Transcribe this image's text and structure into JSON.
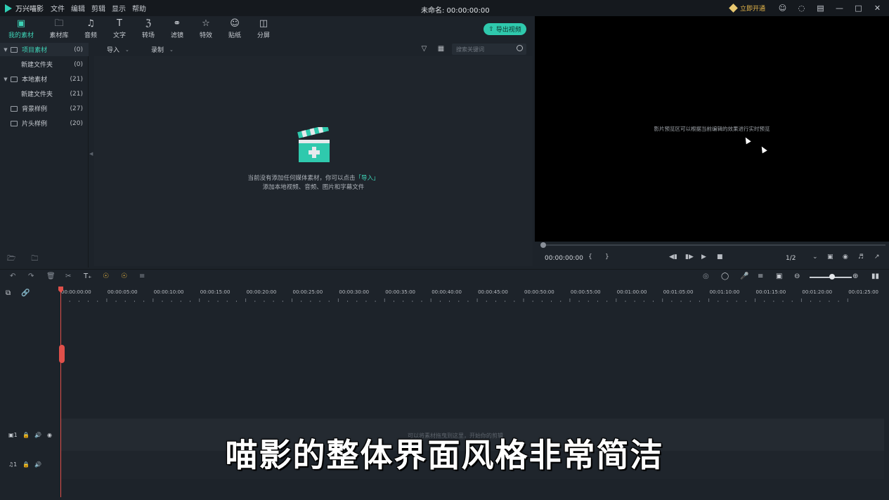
{
  "app": {
    "name": "万兴喵影",
    "menus": [
      "文件",
      "编辑",
      "剪辑",
      "显示",
      "帮助"
    ],
    "doc_title": "未命名: 00:00:00:00",
    "vip_label": "立即开通",
    "window_icons": [
      "user-icon",
      "message-icon",
      "layout-icon",
      "minimize-icon",
      "maximize-icon",
      "close-icon"
    ]
  },
  "media_tabs": [
    {
      "label": "我的素材",
      "icon": "media-icon"
    },
    {
      "label": "素材库",
      "icon": "folder-icon"
    },
    {
      "label": "音频",
      "icon": "music-icon"
    },
    {
      "label": "文字",
      "icon": "text-icon"
    },
    {
      "label": "转场",
      "icon": "transition-icon"
    },
    {
      "label": "滤镜",
      "icon": "filter-icon"
    },
    {
      "label": "特效",
      "icon": "effects-icon"
    },
    {
      "label": "贴纸",
      "icon": "sticker-icon"
    },
    {
      "label": "分屏",
      "icon": "splitscreen-icon"
    }
  ],
  "export_button": "导出视频",
  "folders": [
    {
      "label": "项目素材",
      "count": "(0)"
    },
    {
      "label": "新建文件夹",
      "count": "(0)"
    },
    {
      "label": "本地素材",
      "count": "(21)"
    },
    {
      "label": "新建文件夹",
      "count": "(21)"
    },
    {
      "label": "背景样例",
      "count": "(27)"
    },
    {
      "label": "片头样例",
      "count": "(20)"
    }
  ],
  "media_bar": {
    "import_label": "导入",
    "record_label": "录制",
    "search_placeholder": "搜索关键词"
  },
  "empty_state": {
    "line1_a": "当前没有添加任何媒体素材，你可以点击",
    "line1_link": "「导入」",
    "line2": "添加本地视频、音频、图片和字幕文件"
  },
  "preview": {
    "hint": "影片预览区可以根据当前编辑的效果进行实时预览",
    "timecode": "00:00:00:00",
    "ratio": "1/2"
  },
  "ruler_labels": [
    "00:00:00:00",
    "00:00:05:00",
    "00:00:10:00",
    "00:00:15:00",
    "00:00:20:00",
    "00:00:25:00",
    "00:00:30:00",
    "00:00:35:00",
    "00:00:40:00",
    "00:00:45:00",
    "00:00:50:00",
    "00:00:55:00",
    "00:01:00:00",
    "00:01:05:00",
    "00:01:10:00",
    "00:01:15:00",
    "00:01:20:00",
    "00:01:25:00"
  ],
  "tracks": {
    "video_label": "1",
    "audio_label": "1",
    "drop_hint": "可以将素材拖曳到这里，开始你的剪辑"
  },
  "subtitle": "喵影的整体界面风格非常简洁",
  "colors": {
    "accent": "#2fc9ad",
    "playhead": "#e0504a",
    "vip": "#e8b84a"
  }
}
